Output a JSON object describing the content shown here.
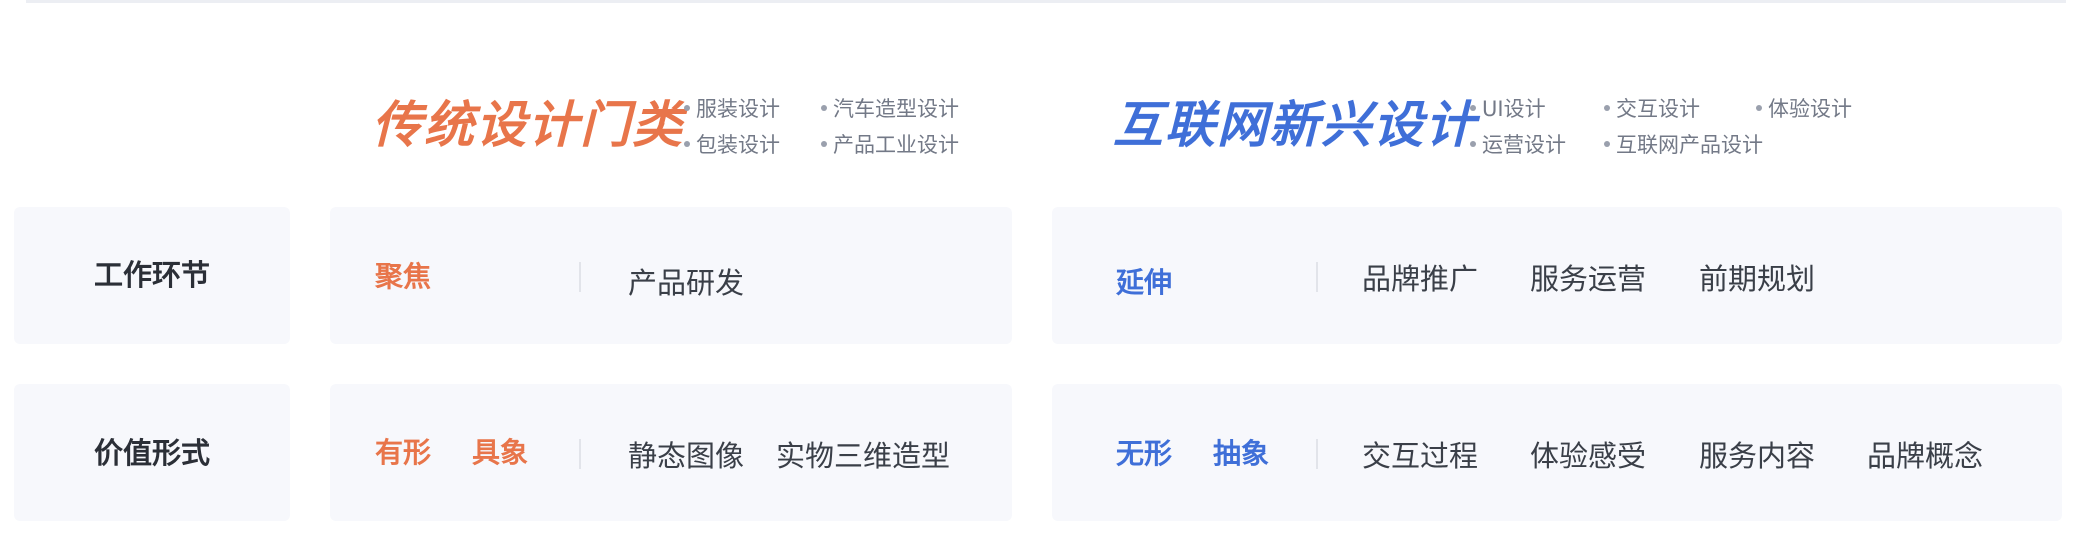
{
  "colors": {
    "traditional_accent": "#e8754a",
    "internet_accent": "#3f6fd8",
    "card_background": "#f7f8fc"
  },
  "traditional": {
    "title": "传统设计门类",
    "tags": [
      "服装设计",
      "汽车造型设计",
      "包装设计",
      "产品工业设计"
    ]
  },
  "internet": {
    "title": "互联网新兴设计",
    "tags": [
      "UI设计",
      "交互设计",
      "体验设计",
      "运营设计",
      "互联网产品设计"
    ]
  },
  "rows": [
    {
      "label": "工作环节",
      "traditional": {
        "keywords": [
          "聚焦"
        ],
        "items": [
          "产品研发"
        ]
      },
      "internet": {
        "keywords": [
          "延伸"
        ],
        "items": [
          "品牌推广",
          "服务运营",
          "前期规划"
        ]
      }
    },
    {
      "label": "价值形式",
      "traditional": {
        "keywords": [
          "有形",
          "具象"
        ],
        "items": [
          "静态图像",
          "实物三维造型"
        ]
      },
      "internet": {
        "keywords": [
          "无形",
          "抽象"
        ],
        "items": [
          "交互过程",
          "体验感受",
          "服务内容",
          "品牌概念"
        ]
      }
    }
  ]
}
